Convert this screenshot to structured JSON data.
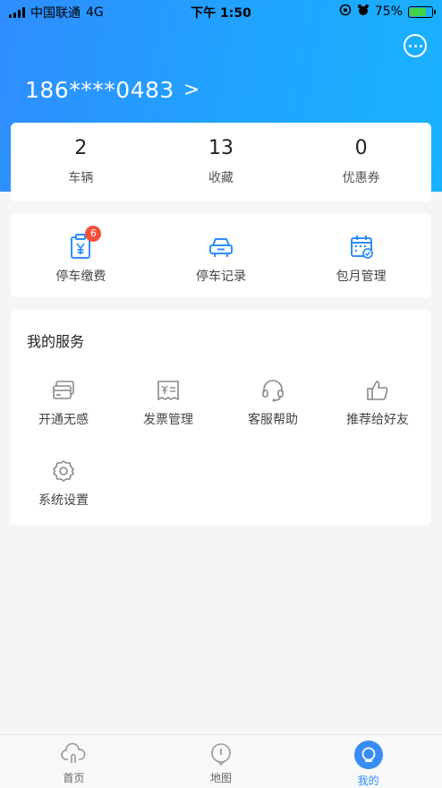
{
  "status_bar": {
    "carrier": "中国联通",
    "network": "4G",
    "time": "下午 1:50",
    "battery": "75%"
  },
  "profile": {
    "phone": "186****0483",
    "chevron": ">"
  },
  "stats": [
    {
      "value": "2",
      "label": "车辆"
    },
    {
      "value": "13",
      "label": "收藏"
    },
    {
      "value": "0",
      "label": "优惠券"
    }
  ],
  "quick_actions": [
    {
      "label": "停车缴费",
      "icon": "parking-fee-icon",
      "badge": "6"
    },
    {
      "label": "停车记录",
      "icon": "car-icon"
    },
    {
      "label": "包月管理",
      "icon": "calendar-icon"
    }
  ],
  "services": {
    "title": "我的服务",
    "items": [
      {
        "label": "开通无感",
        "icon": "card-icon"
      },
      {
        "label": "发票管理",
        "icon": "invoice-icon"
      },
      {
        "label": "客服帮助",
        "icon": "headset-icon"
      },
      {
        "label": "推荐给好友",
        "icon": "thumbs-up-icon"
      },
      {
        "label": "系统设置",
        "icon": "gear-icon"
      }
    ]
  },
  "tabbar": [
    {
      "label": "首页",
      "icon": "home-cloud-icon"
    },
    {
      "label": "地图",
      "icon": "map-pin-icon"
    },
    {
      "label": "我的",
      "icon": "profile-icon",
      "active": true
    }
  ],
  "colors": {
    "brand_blue": "#2f8dff",
    "badge_red": "#f4513a",
    "battery_green": "#3fd34b"
  }
}
